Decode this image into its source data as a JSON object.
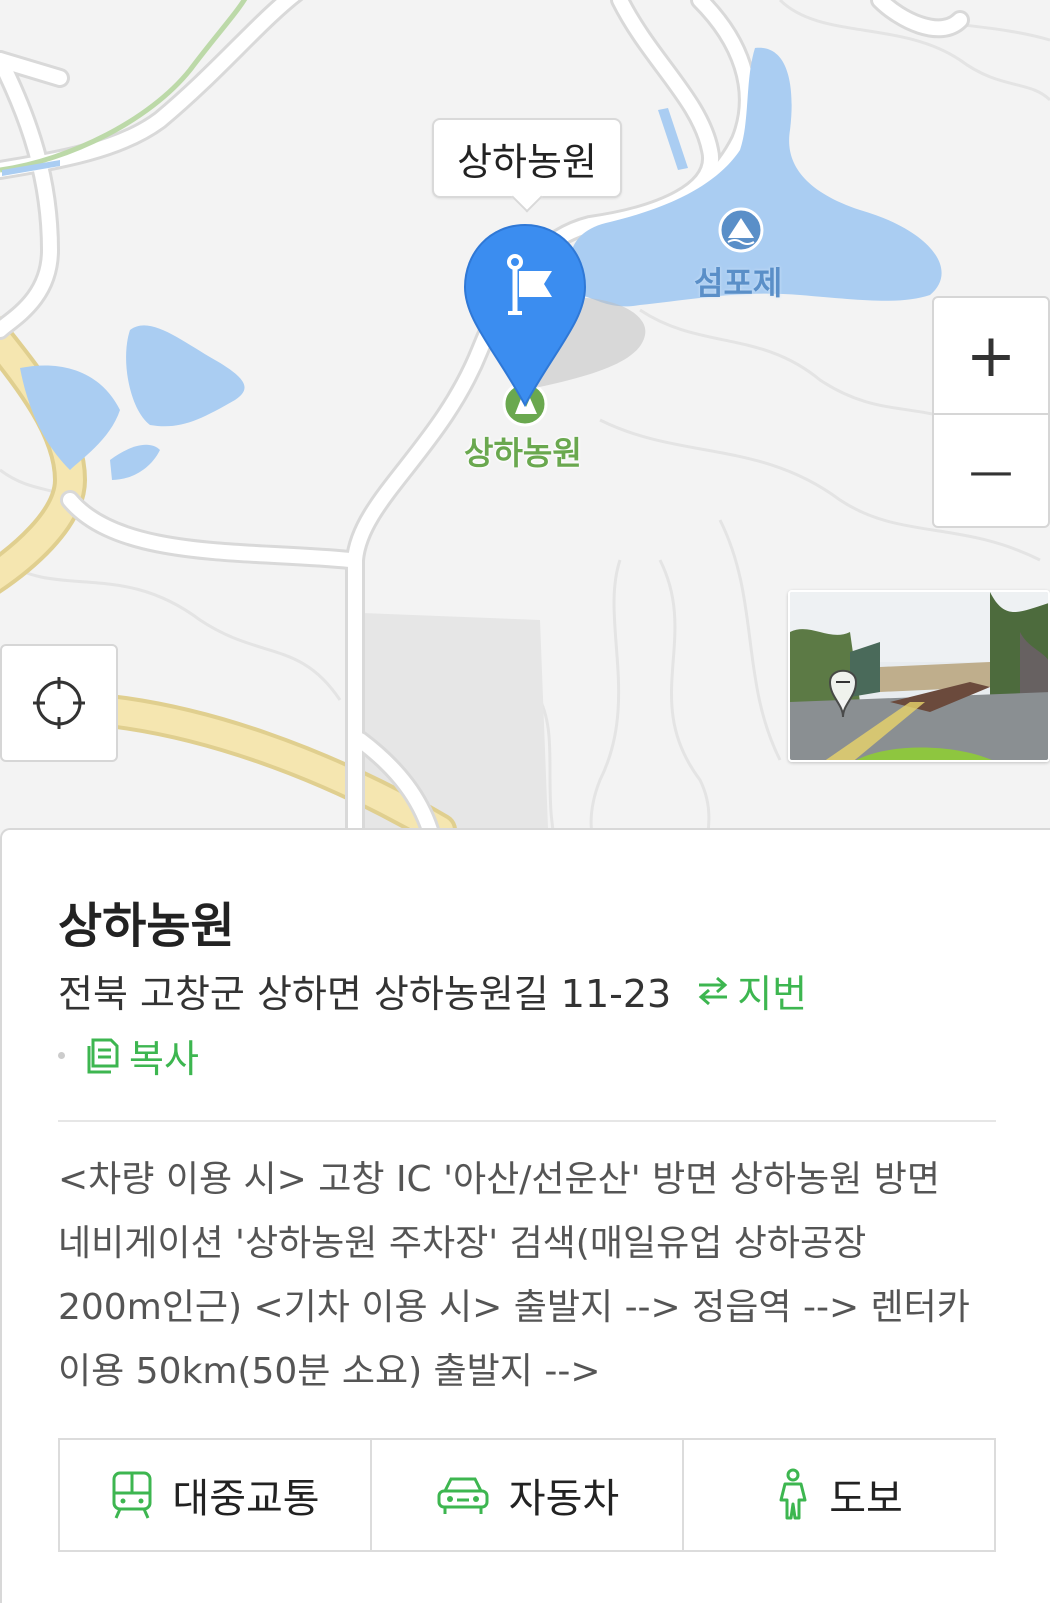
{
  "map": {
    "callout_label": "상하농원",
    "poi_label": "상하농원",
    "lake_label": "섬포제",
    "zoom_in_label": "+",
    "zoom_out_label": "—",
    "colors": {
      "marker": "#3b8df0",
      "water": "#aacdf2",
      "road_major": "#f4e2a6",
      "poi_green": "#6aa84f"
    }
  },
  "panel": {
    "title": "상하농원",
    "address": "전북 고창군 상하면 상하농원길 11-23",
    "jibun_label": "지번",
    "copy_label": "복사",
    "description": "<차량 이용 시> 고창 IC '아산/선운산' 방면 상하농원 방면 네비게이션 '상하농원 주차장' 검색(매일유업 상하공장 200m인근) <기차 이용 시> 출발지 --> 정읍역 --> 렌터카 이용 50km(50분 소요) 출발지 -->",
    "routes": [
      {
        "label": "대중교통",
        "icon": "bus-icon"
      },
      {
        "label": "자동차",
        "icon": "car-icon"
      },
      {
        "label": "도보",
        "icon": "walk-icon"
      }
    ],
    "accent_color": "#3db650"
  }
}
